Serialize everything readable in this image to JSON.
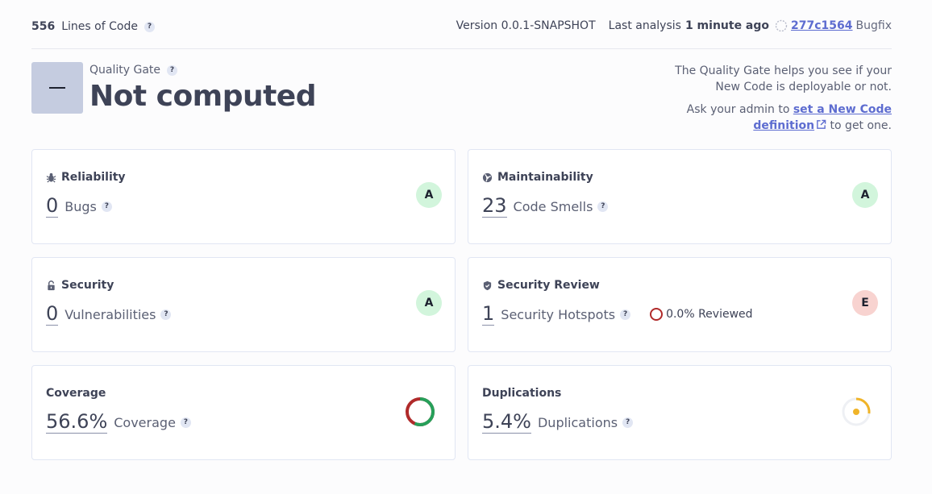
{
  "topbar": {
    "lines_value": "556",
    "lines_label": "Lines of Code",
    "version": "Version 0.0.1-SNAPSHOT",
    "last_analysis_label": "Last analysis",
    "last_analysis_value": "1 minute ago",
    "commit": "277c1564",
    "branch": "Bugfix"
  },
  "quality_gate": {
    "label": "Quality Gate",
    "status": "Not computed",
    "info_line": "The Quality Gate helps you see if your New Code is deployable or not.",
    "ask_prefix": "Ask your admin to",
    "link": "set a New Code definition",
    "ask_suffix": "to get one."
  },
  "cards": {
    "reliability": {
      "title": "Reliability",
      "value": "0",
      "unit": "Bugs",
      "rating": "A",
      "icon": "bug-icon"
    },
    "maintainability": {
      "title": "Maintainability",
      "value": "23",
      "unit": "Code Smells",
      "rating": "A",
      "icon": "code-smell-icon"
    },
    "security": {
      "title": "Security",
      "value": "0",
      "unit": "Vulnerabilities",
      "rating": "A",
      "icon": "lock-icon"
    },
    "security_review": {
      "title": "Security Review",
      "value": "1",
      "unit": "Security Hotspots",
      "reviewed": "0.0% Reviewed",
      "rating": "E",
      "icon": "shield-icon"
    },
    "coverage": {
      "title": "Coverage",
      "value": "56.6%",
      "unit": "Coverage",
      "percent": 56.6
    },
    "duplications": {
      "title": "Duplications",
      "value": "5.4%",
      "unit": "Duplications",
      "percent": 5.4
    }
  },
  "help_glyph": "?",
  "colors": {
    "rating_good": "#d2f5dc",
    "rating_bad": "#f8d3d0",
    "coverage_covered": "#26a05a",
    "coverage_uncovered": "#b02a2a",
    "duplication_accent": "#f0b429",
    "link": "#5d6cd0"
  }
}
